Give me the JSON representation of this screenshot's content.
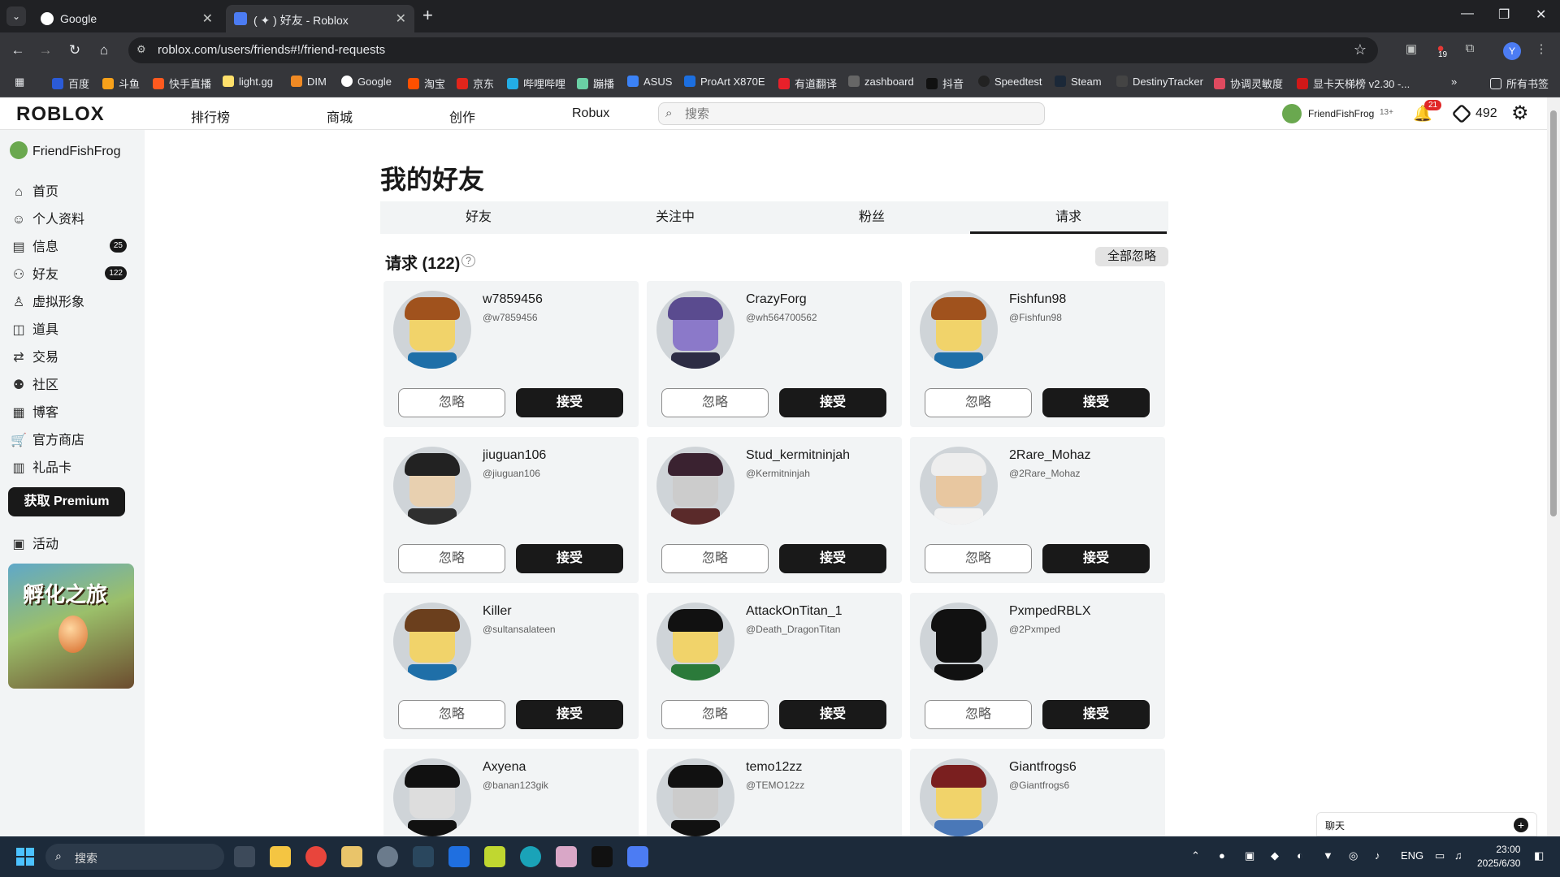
{
  "browser": {
    "tabs": [
      {
        "title": "Google",
        "active": false
      },
      {
        "title": "( ✦ ) 好友 - Roblox",
        "active": true
      }
    ],
    "url": "roblox.com/users/friends#!/friend-requests",
    "extension_badge": "19",
    "profile_letter": "Y",
    "bookmarks": [
      "百度",
      "斗鱼",
      "快手直播",
      "light.gg",
      "DIM",
      "Google",
      "淘宝",
      "京东",
      "哔哩哔哩",
      "蹦播",
      "ASUS",
      "ProArt X870E",
      "有道翻译",
      "zashboard",
      "抖音",
      "Speedtest",
      "Steam",
      "DestinyTracker",
      "协调灵敏度",
      "显卡天梯榜 v2.30 -..."
    ],
    "all_bookmarks": "所有书签"
  },
  "roblox": {
    "logo": "ROBLOX",
    "nav": [
      "排行榜",
      "商城",
      "创作",
      "Robux"
    ],
    "search_placeholder": "搜索",
    "account_name": "FriendFishFrog",
    "age_tag": "13+",
    "notifications": "21",
    "robux": "492"
  },
  "sidebar": {
    "username": "FriendFishFrog",
    "items": [
      {
        "label": "首页",
        "icon": "home-icon"
      },
      {
        "label": "个人资料",
        "icon": "profile-icon"
      },
      {
        "label": "信息",
        "icon": "message-icon",
        "badge": "25"
      },
      {
        "label": "好友",
        "icon": "friends-icon",
        "badge": "122"
      },
      {
        "label": "虚拟形象",
        "icon": "avatar-icon"
      },
      {
        "label": "道具",
        "icon": "inventory-icon"
      },
      {
        "label": "交易",
        "icon": "trade-icon"
      },
      {
        "label": "社区",
        "icon": "community-icon"
      },
      {
        "label": "博客",
        "icon": "blog-icon"
      },
      {
        "label": "官方商店",
        "icon": "store-icon"
      },
      {
        "label": "礼品卡",
        "icon": "giftcard-icon"
      }
    ],
    "premium_label": "获取 Premium",
    "events_label": "活动",
    "promo_text": "孵化之旅"
  },
  "main": {
    "title": "我的好友",
    "tabs": [
      "好友",
      "关注中",
      "粉丝",
      "请求"
    ],
    "selected_tab": "请求",
    "requests_title": "请求 (122)",
    "ignore_all": "全部忽略",
    "ignore_label": "忽略",
    "accept_label": "接受",
    "requests": [
      {
        "name": "w7859456",
        "handle": "@w7859456"
      },
      {
        "name": "CrazyForg",
        "handle": "@wh564700562"
      },
      {
        "name": "Fishfun98",
        "handle": "@Fishfun98"
      },
      {
        "name": "jiuguan106",
        "handle": "@jiuguan106"
      },
      {
        "name": "Stud_kermitninjah",
        "handle": "@Kermitninjah"
      },
      {
        "name": "2Rare_Mohaz",
        "handle": "@2Rare_Mohaz"
      },
      {
        "name": "Killer",
        "handle": "@sultansalateen"
      },
      {
        "name": "AttackOnTitan_1",
        "handle": "@Death_DragonTitan"
      },
      {
        "name": "PxmpedRBLX",
        "handle": "@2Pxmped"
      },
      {
        "name": "Axyena",
        "handle": "@banan123gik"
      },
      {
        "name": "temo12zz",
        "handle": "@TEMO12zz"
      },
      {
        "name": "Giantfrogs6",
        "handle": "@Giantfrogs6"
      }
    ]
  },
  "chat": {
    "label": "聊天"
  },
  "taskbar": {
    "search_label": "搜索",
    "lang": "ENG",
    "time": "23:00",
    "date": "2025/6/30"
  }
}
